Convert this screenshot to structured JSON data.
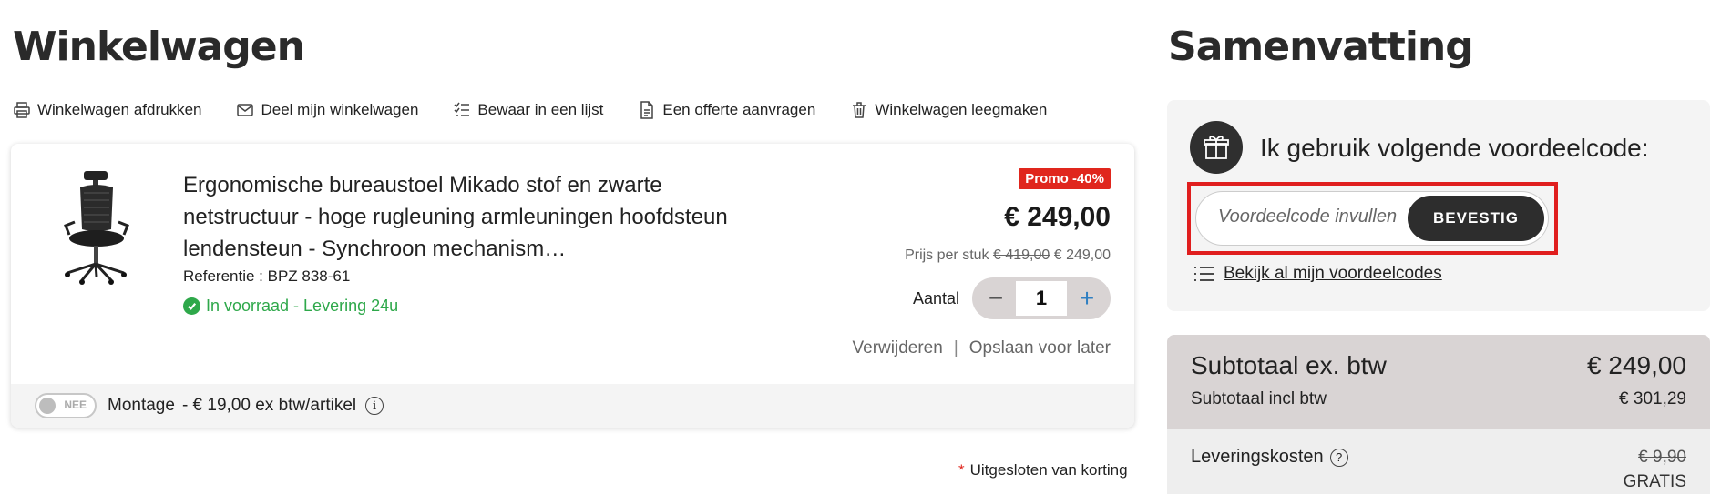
{
  "header": {
    "title": "Winkelwagen",
    "summary_title": "Samenvatting"
  },
  "toolbar": [
    {
      "label": "Winkelwagen afdrukken",
      "icon": "printer-icon"
    },
    {
      "label": "Deel mijn winkelwagen",
      "icon": "mail-icon"
    },
    {
      "label": "Bewaar in een lijst",
      "icon": "checklist-icon"
    },
    {
      "label": "Een offerte aanvragen",
      "icon": "document-icon"
    },
    {
      "label": "Winkelwagen leegmaken",
      "icon": "trash-icon"
    }
  ],
  "product": {
    "title": "Ergonomische bureaustoel Mikado stof en zwarte netstructuur - hoge rugleuning armleuningen hoofdsteun lendensteun - Synchroon mechanism…",
    "reference": "Referentie : BPZ 838-61",
    "stock": "In voorraad - Levering 24u",
    "promo": "Promo -40%",
    "price": "€ 249,00",
    "unit_price_label": "Prijs per stuk",
    "unit_price_old": "€ 419,00",
    "unit_price_new": "€ 249,00",
    "quantity_label": "Aantal",
    "quantity": "1",
    "remove": "Verwijderen",
    "save_later": "Opslaan voor later",
    "montage_toggle": "NEE",
    "montage_label": "Montage",
    "montage_price": "- € 19,00 ex btw/artikel"
  },
  "excluded_note": "Uitgesloten van korting",
  "voucher": {
    "label": "Ik gebruik volgende voordeelcode:",
    "placeholder": "Voordeelcode invullen",
    "confirm": "BEVESTIG",
    "view_all": "Bekijk al mijn voordeelcodes"
  },
  "totals": {
    "subtotal_ex_label": "Subtotaal ex. btw",
    "subtotal_ex": "€ 249,00",
    "subtotal_incl_label": "Subtotaal incl btw",
    "subtotal_incl": "€ 301,29",
    "shipping_label": "Leveringskosten",
    "shipping_old": "€ 9,90",
    "shipping_new": "GRATIS"
  },
  "colors": {
    "promo": "#e0261d",
    "stock": "#2ea84a",
    "highlight_frame": "#e01e1e",
    "button_dark": "#2d2d2d"
  }
}
